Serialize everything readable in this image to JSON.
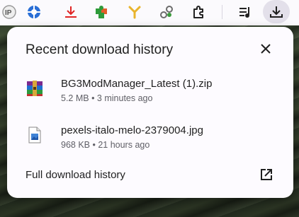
{
  "toolbar": {
    "icons": [
      "ip-icon",
      "crosshair-icon",
      "red-download-icon",
      "puzzle-green-icon",
      "yellow-fork-icon",
      "link-icon",
      "extensions-puzzle-icon",
      "media-queue-icon",
      "download-icon"
    ]
  },
  "popup": {
    "title": "Recent download history",
    "items": [
      {
        "file_name": "BG3ModManager_Latest (1).zip",
        "meta": "5.2 MB • 3 minutes ago",
        "icon": "zip-archive-icon"
      },
      {
        "file_name": "pexels-italo-melo-2379004.jpg",
        "meta": "968 KB • 21 hours ago",
        "icon": "image-file-icon"
      }
    ],
    "full_history_label": "Full download history"
  },
  "colors": {
    "panel_bg": "#fdfbff",
    "text": "#1f1f1f",
    "meta_text": "#5f5f66",
    "active_button_bg": "#e3e0ea"
  }
}
